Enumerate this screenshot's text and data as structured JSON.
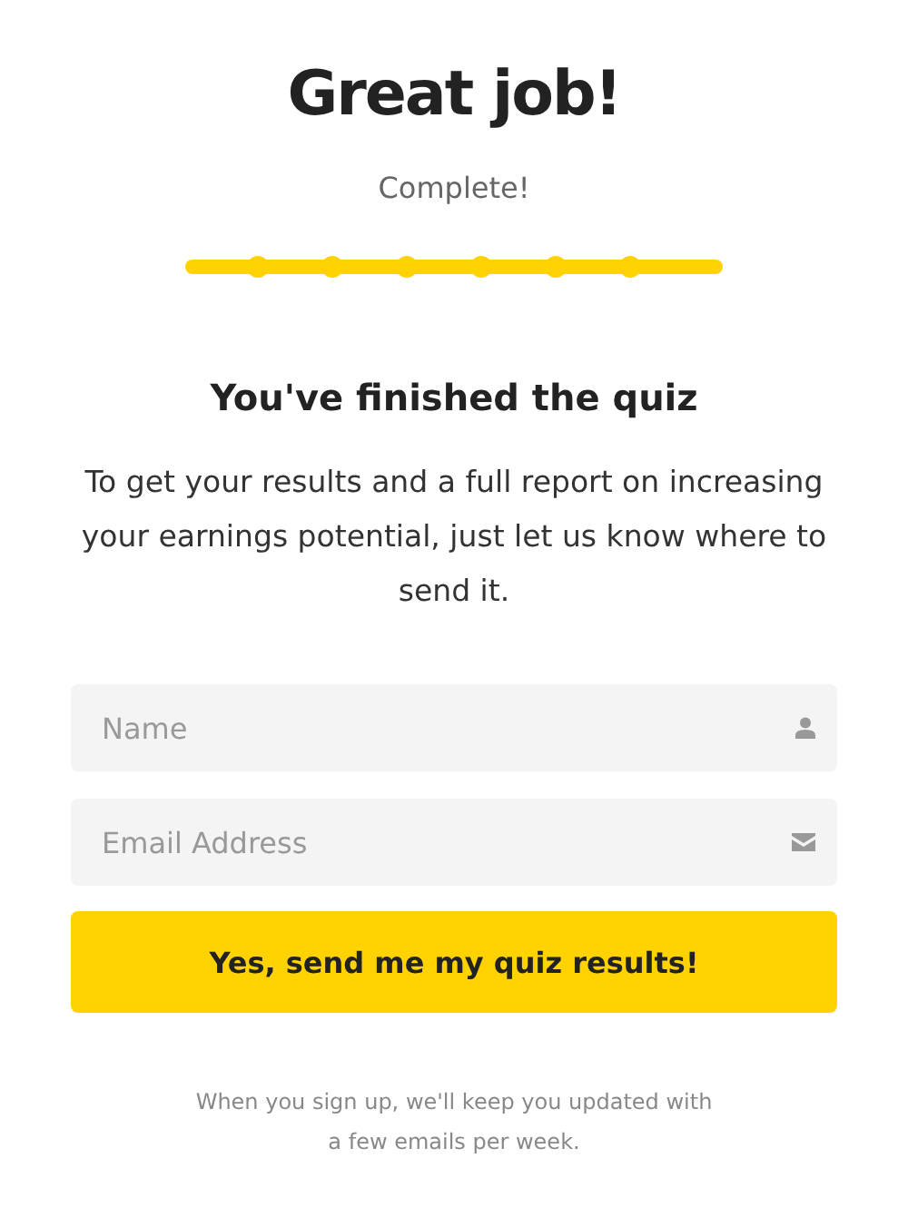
{
  "title": "Great job!",
  "status": "Complete!",
  "progress": {
    "level": 1
  },
  "heading": "You've finished the quiz",
  "description": "To get your results and a full report on increasing your earnings potential, just let us know where to send it.",
  "fields": [
    {
      "kind": "name",
      "placeholder": "Name"
    },
    {
      "kind": "email",
      "placeholder": "Email Address"
    }
  ],
  "submit_button": "Yes, send me my quiz results!",
  "footnote": "When you sign up, we'll keep you updated with a few emails per week."
}
